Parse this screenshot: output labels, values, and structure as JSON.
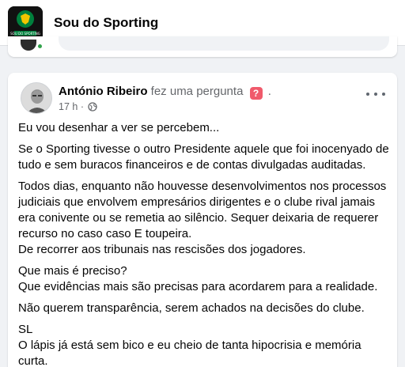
{
  "group": {
    "name": "Sou do Sporting",
    "logo_text": "SOU DO SPORTING"
  },
  "post": {
    "author": "António Ribeiro",
    "action": "fez uma pergunta",
    "question_badge": "?",
    "dot": ".",
    "time": "17 h",
    "time_sep": "·",
    "lines": [
      [
        "Eu vou desenhar a ver se percebem..."
      ],
      [
        "Se o Sporting tivesse o outro Presidente aquele que foi inocenyado de",
        "tudo e sem buracos financeiros e de contas divulgadas auditadas."
      ],
      [
        "Todos dias, enquanto não houvesse desenvolvimentos nos processos",
        "judiciais que envolvem empresários  dirigentes e o clube rival jamais",
        "era conivente ou se remetia ao silêncio. Sequer deixaria de requerer",
        "recurso no caso caso E toupeira.",
        "De recorrer aos tribunais nas rescisões dos jogadores."
      ],
      [
        "Que mais é preciso?",
        "Que evidências mais são precisas para acordarem para a realidade."
      ],
      [
        "Não querem transparência, serem achados na decisões do clube."
      ],
      [
        "SL",
        "O lápis já está sem bico e eu cheio de tanta hipocrisia e memória",
        "curta."
      ]
    ]
  },
  "icons": {
    "globe": "globe-icon",
    "more": "more-options-icon"
  },
  "colors": {
    "brand_green": "#00803d",
    "question_badge": "#f05a6b",
    "online": "#31a24c"
  }
}
